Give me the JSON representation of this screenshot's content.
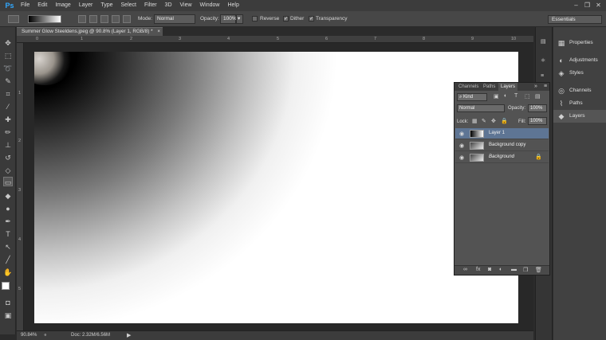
{
  "app": {
    "logo": "Ps"
  },
  "menu": [
    "File",
    "Edit",
    "Image",
    "Layer",
    "Type",
    "Select",
    "Filter",
    "3D",
    "View",
    "Window",
    "Help"
  ],
  "window_controls": {
    "minimize": "–",
    "restore": "❐",
    "close": "✕"
  },
  "options_bar": {
    "mode_label": "Mode:",
    "mode_value": "Normal",
    "opacity_label": "Opacity:",
    "opacity_value": "100%",
    "reverse_label": "Reverse",
    "dither_label": "Dither",
    "transparency_label": "Transparency",
    "dither_checked": true,
    "transparency_checked": true,
    "reverse_checked": false
  },
  "workspace": {
    "value": "Essentials"
  },
  "document": {
    "tab_title": "Summer Glow Steeldens.jpeg @ 90.8% (Layer 1, RGB/8) *",
    "close_glyph": "×",
    "zoom": "90.84%",
    "doc_size": "Doc: 2.32M/6.56M",
    "ruler_h": [
      "0",
      "1",
      "2",
      "3",
      "4",
      "5",
      "6",
      "7",
      "8",
      "9",
      "10"
    ],
    "ruler_v": [
      "1",
      "2",
      "3",
      "4",
      "5"
    ]
  },
  "collapsed_panels": [
    {
      "label": "Properties",
      "icon": "properties-icon",
      "glyph": "▦"
    },
    {
      "label": "Adjustments",
      "icon": "adjustments-icon",
      "glyph": "◐"
    },
    {
      "label": "Styles",
      "icon": "styles-icon",
      "glyph": "◈"
    },
    {
      "label": "Channels",
      "icon": "channels-icon",
      "glyph": "◎"
    },
    {
      "label": "Paths",
      "icon": "paths-icon",
      "glyph": "⌇"
    },
    {
      "label": "Layers",
      "icon": "layers-icon",
      "glyph": "◆"
    }
  ],
  "layers_panel": {
    "tabs": [
      "Channels",
      "Paths",
      "Layers"
    ],
    "active_tab": "Layers",
    "kind_filter": "Kind",
    "blend_mode": "Normal",
    "opacity_label": "Opacity:",
    "opacity_value": "100%",
    "lock_label": "Lock:",
    "fill_label": "Fill:",
    "fill_value": "100%",
    "layers": [
      {
        "name": "Layer 1",
        "selected": true,
        "locked": false
      },
      {
        "name": "Background copy",
        "selected": false,
        "locked": false
      },
      {
        "name": "Background",
        "selected": false,
        "locked": true
      }
    ]
  },
  "colors": {
    "accent": "#31a8ff",
    "selection": "#5e7594",
    "panel": "#535353"
  }
}
